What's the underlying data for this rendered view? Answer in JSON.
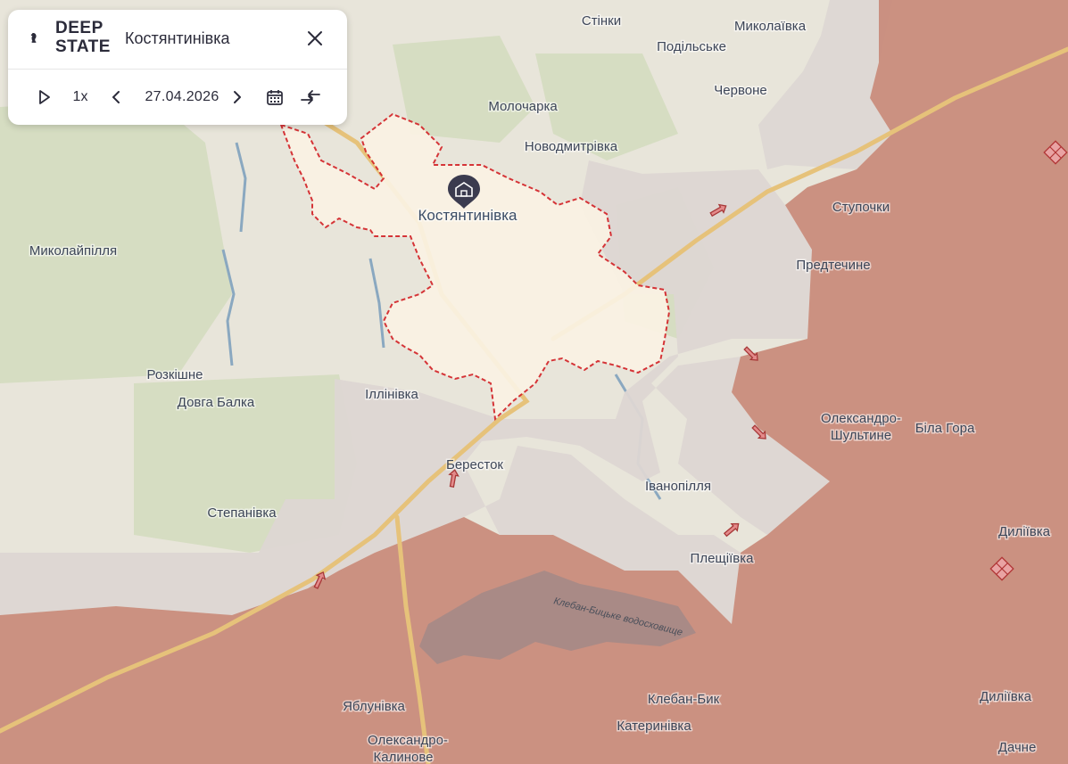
{
  "panel": {
    "logo_line1": "DEEP",
    "logo_line2": "STATE",
    "title": "Костянтинівка",
    "speed": "1x",
    "date": "27.04.2026"
  },
  "icons": {
    "logo": "knight-chess-icon",
    "close": "close-icon",
    "play": "play-icon",
    "prev": "chevron-left-icon",
    "next": "chevron-right-icon",
    "calendar": "calendar-icon",
    "compare": "compare-arrows-icon",
    "city_marker": "city-marker-icon",
    "attack": "attack-arrow-icon",
    "fortification": "fortification-icon"
  },
  "colors": {
    "occupied": "#c88a7a",
    "contested": "#ddd6d3",
    "city_zone": "#fbf3e4",
    "zone_border": "#d4262a",
    "road": "#e6c27a",
    "water": "#8aa8c0"
  },
  "places": {
    "stinky": "Стінки",
    "mykolaivka_n": "Миколаївка",
    "podilske": "Подільське",
    "molocharka": "Молочарка",
    "chervone": "Червоне",
    "novodmytrivka": "Новодмитрівка",
    "kostiantynivka": "Костянтинівка",
    "stupochky": "Ступочки",
    "mykolaipillia": "Миколайпілля",
    "predtechyne": "Предтечине",
    "rozkishne": "Розкішне",
    "dovha_balka": "Довга Балка",
    "illinivka": "Іллінівка",
    "oleksandro_shultyne_1": "Олександро-",
    "oleksandro_shultyne_2": "Шультине",
    "bila_hora": "Біла Гора",
    "berestok": "Бересток",
    "ivanopillia": "Іванопілля",
    "stepanivka": "Степанівка",
    "dyliivka_1": "Диліївка",
    "pleshchiivka": "Плещіївка",
    "kleban_byk": "Клебан-Бик",
    "katerynivka": "Катеринівка",
    "yablunivka": "Яблунівка",
    "oleksandro_kalynove_1": "Олександро-",
    "oleksandro_kalynove_2": "Калинове",
    "dyliivka_2": "Диліївка",
    "dachne": "Дачне",
    "reservoir": "Клебан-Бицьке водосховище"
  }
}
